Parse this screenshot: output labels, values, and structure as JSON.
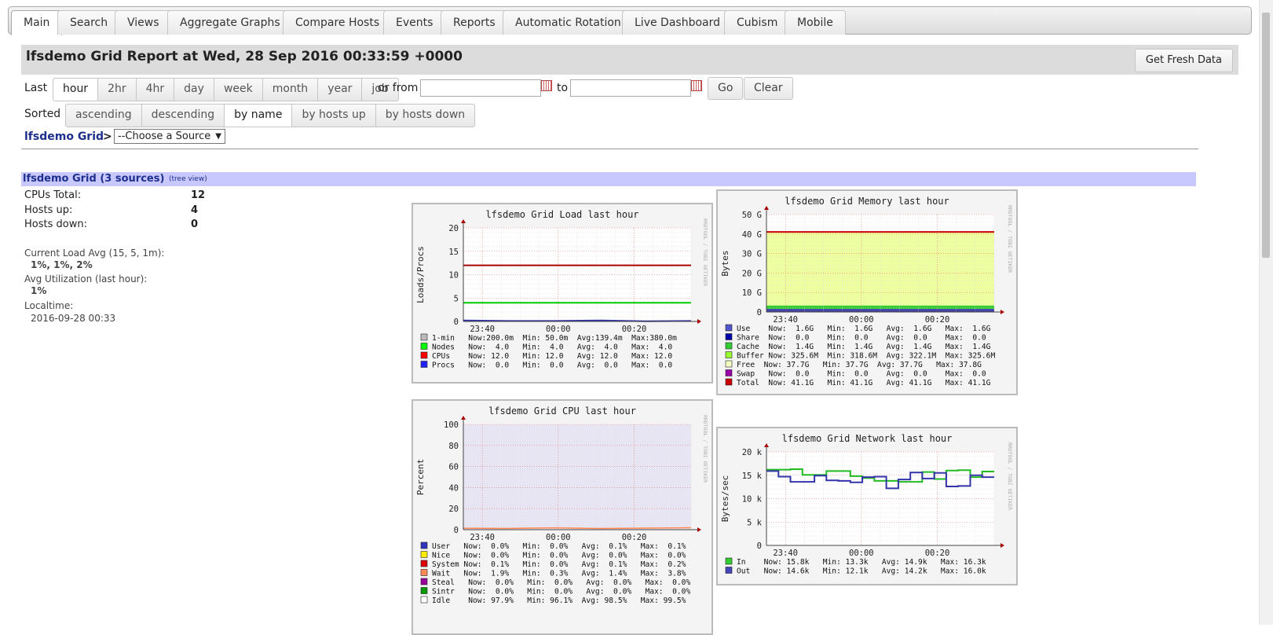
{
  "tabs": [
    "Main",
    "Search",
    "Views",
    "Aggregate Graphs",
    "Compare Hosts",
    "Events",
    "Reports",
    "Automatic Rotation",
    "Live Dashboard",
    "Cubism",
    "Mobile"
  ],
  "header": {
    "title": "lfsdemo Grid Report at Wed, 28 Sep 2016 00:33:59 +0000",
    "fresh_button": "Get Fresh Data"
  },
  "range": {
    "label": "Last",
    "options": [
      "hour",
      "2hr",
      "4hr",
      "day",
      "week",
      "month",
      "year",
      "job"
    ],
    "selected": "hour",
    "from_label": "or from",
    "to_label": "to",
    "from_value": "",
    "to_value": "",
    "go": "Go",
    "clear": "Clear"
  },
  "sorted": {
    "label": "Sorted",
    "options": [
      "ascending",
      "descending",
      "by name",
      "by hosts up",
      "by hosts down"
    ],
    "selected": "by name"
  },
  "breadcrumb": {
    "grid": "lfsdemo Grid",
    "sep": ">",
    "source_select": "--Choose a Source"
  },
  "grid": {
    "title": "lfsdemo Grid (3 sources)",
    "tree_link": "(tree view)",
    "cpus_label": "CPUs Total:",
    "cpus": "12",
    "hosts_up_label": "Hosts up:",
    "hosts_up": "4",
    "hosts_down_label": "Hosts down:",
    "hosts_down": "0",
    "load_label": "Current Load Avg (15, 5, 1m):",
    "load": "1%, 1%, 2%",
    "util_label": "Avg Utilization (last hour):",
    "util": "1%",
    "localtime_label": "Localtime:",
    "localtime": "2016-09-28 00:33"
  },
  "watermark": "RRDTOOL / TOBI OETIKER",
  "chart_data": [
    {
      "type": "line",
      "title": "lfsdemo Grid Load last hour",
      "ylabel": "Loads/Procs",
      "ylim": [
        0,
        20
      ],
      "yticks": [
        "0",
        "5",
        "10",
        "15",
        "20"
      ],
      "xticks": [
        "23:40",
        "00:00",
        "00:20"
      ],
      "legend": [
        {
          "name": "1-min",
          "color": "#bbbbbb",
          "text": "1-min   Now:200.0m  Min: 50.0m  Avg:139.4m  Max:380.0m"
        },
        {
          "name": "Nodes",
          "color": "#00ff00",
          "text": "Nodes   Now:  4.0   Min:  4.0   Avg:  4.0   Max:  4.0"
        },
        {
          "name": "CPUs",
          "color": "#ff0000",
          "text": "CPUs    Now: 12.0   Min: 12.0   Avg: 12.0   Max: 12.0"
        },
        {
          "name": "Procs",
          "color": "#2222ff",
          "text": "Procs   Now:  0.0   Min:  0.0   Avg:  0.0   Max:  0.0"
        }
      ],
      "series": [
        {
          "name": "CPUs",
          "color": "#aa0000",
          "values": [
            12,
            12
          ]
        },
        {
          "name": "Nodes",
          "color": "#00cc00",
          "values": [
            4,
            4
          ]
        },
        {
          "name": "1-min",
          "color": "#3333aa",
          "values": [
            0.2,
            0.1,
            0.1,
            0.2,
            0.05,
            0.1
          ]
        }
      ]
    },
    {
      "type": "area",
      "title": "lfsdemo Grid Memory last hour",
      "ylabel": "Bytes",
      "ylim": [
        0,
        50
      ],
      "yticks": [
        "0",
        "10 G",
        "20 G",
        "30 G",
        "40 G",
        "50 G"
      ],
      "xticks": [
        "23:40",
        "00:00",
        "00:20"
      ],
      "legend": [
        {
          "name": "Use",
          "color": "#5555cc",
          "text": "Use    Now:  1.6G   Min:  1.6G   Avg:  1.6G   Max:  1.6G"
        },
        {
          "name": "Share",
          "color": "#0000aa",
          "text": "Share  Now:  0.0    Min:  0.0    Avg:  0.0    Max:  0.0"
        },
        {
          "name": "Cache",
          "color": "#33cc33",
          "text": "Cache  Now:  1.4G   Min:  1.4G   Avg:  1.4G   Max:  1.4G"
        },
        {
          "name": "Buffer",
          "color": "#99ff33",
          "text": "Buffer Now: 325.6M  Min: 318.6M  Avg: 322.1M  Max: 325.6M"
        },
        {
          "name": "Free",
          "color": "#f0ffc0",
          "text": "Free  Now: 37.7G   Min: 37.7G  Avg: 37.7G   Max: 37.8G"
        },
        {
          "name": "Swap",
          "color": "#9900aa",
          "text": "Swap   Now:  0.0    Min:  0.0    Avg:  0.0    Max:  0.0"
        },
        {
          "name": "Total",
          "color": "#cc0000",
          "text": "Total  Now: 41.1G   Min: 41.1G   Avg: 41.1G   Max: 41.1G"
        }
      ],
      "series": [
        {
          "name": "Total",
          "color": "#cc0000",
          "values": [
            41.1,
            41.1
          ]
        },
        {
          "name": "Free",
          "color": "#eeffa0",
          "values": [
            41.1,
            41.1
          ]
        }
      ]
    },
    {
      "type": "area",
      "title": "lfsdemo Grid CPU last hour",
      "ylabel": "Percent",
      "ylim": [
        0,
        100
      ],
      "yticks": [
        "0",
        "20",
        "40",
        "60",
        "80",
        "100"
      ],
      "xticks": [
        "23:40",
        "00:00",
        "00:20"
      ],
      "legend": [
        {
          "name": "User",
          "color": "#3333bb",
          "text": "User   Now:  0.0%   Min:  0.0%   Avg:  0.1%   Max:  0.1%"
        },
        {
          "name": "Nice",
          "color": "#ffee00",
          "text": "Nice   Now:  0.0%   Min:  0.0%   Avg:  0.0%   Max:  0.0%"
        },
        {
          "name": "System",
          "color": "#dd0000",
          "text": "System Now:  0.1%   Min:  0.0%   Avg:  0.1%   Max:  0.2%"
        },
        {
          "name": "Wait",
          "color": "#ff8855",
          "text": "Wait   Now:  1.9%   Min:  0.3%   Avg:  1.4%   Max:  3.8%"
        },
        {
          "name": "Steal",
          "color": "#990099",
          "text": "Steal   Now:  0.0%   Min:  0.0%   Avg:  0.0%   Max:  0.0%"
        },
        {
          "name": "Sintr",
          "color": "#009900",
          "text": "Sintr   Now:  0.0%   Min:  0.0%   Avg:  0.0%   Max:  0.0%"
        },
        {
          "name": "Idle",
          "color": "#ffffff",
          "text": "Idle    Now: 97.9%   Min: 96.1%  Avg: 98.5%   Max: 99.5%"
        }
      ],
      "series": [
        {
          "name": "Wait",
          "color": "#ff8855",
          "values": [
            1.4,
            1.2,
            1.8,
            1.1,
            1.5,
            1.9
          ]
        }
      ]
    },
    {
      "type": "line",
      "title": "lfsdemo Grid Network last hour",
      "ylabel": "Bytes/sec",
      "ylim": [
        0,
        20
      ],
      "yticks": [
        "0",
        "5 k",
        "10 k",
        "15 k",
        "20 k"
      ],
      "xticks": [
        "23:40",
        "00:00",
        "00:20"
      ],
      "legend": [
        {
          "name": "In",
          "color": "#33cc33",
          "text": "In    Now: 15.8k   Min: 13.3k   Avg: 14.9k   Max: 16.3k"
        },
        {
          "name": "Out",
          "color": "#4444bb",
          "text": "Out   Now: 14.6k   Min: 12.1k   Avg: 14.2k   Max: 16.0k"
        }
      ],
      "series": [
        {
          "name": "In",
          "color": "#22bb22",
          "values": [
            16.2,
            16.2,
            16.3,
            15.1,
            15.1,
            15.9,
            15.9,
            14.8,
            14.4,
            13.8,
            13.8,
            13.6,
            13.6,
            15.7,
            14.2,
            16.0,
            16.1,
            14.6,
            15.8
          ]
        },
        {
          "name": "Out",
          "color": "#3333aa",
          "values": [
            15.9,
            14.7,
            13.6,
            13.6,
            14.9,
            13.9,
            13.8,
            13.5,
            14.6,
            14.7,
            12.2,
            14.1,
            15.6,
            14.3,
            15.5,
            12.6,
            12.7,
            15.0,
            14.6
          ]
        }
      ]
    }
  ]
}
